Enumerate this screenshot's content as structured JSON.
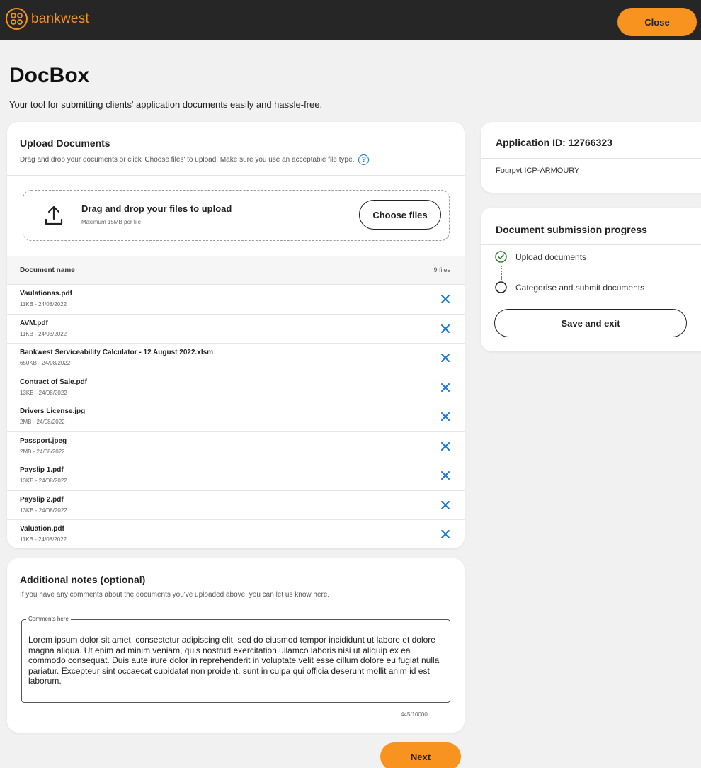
{
  "header": {
    "brand": "bankwest",
    "close_label": "Close",
    "accent_color": "#f7931e"
  },
  "page": {
    "title": "DocBox",
    "subtitle": "Your tool for submitting clients' application documents easily and hassle-free."
  },
  "upload": {
    "title": "Upload Documents",
    "description": "Drag and drop your documents or click 'Choose files' to upload. Make sure you use an acceptable file type.",
    "dropzone_title": "Drag and drop your files to upload",
    "dropzone_sub": "Maximum 15MB per file",
    "choose_label": "Choose files",
    "column_name": "Document name",
    "file_count": "9 files",
    "files": [
      {
        "name": "Vaulationas.pdf",
        "meta": "11KB - 24/08/2022"
      },
      {
        "name": "AVM.pdf",
        "meta": "11KB - 24/08/2022"
      },
      {
        "name": "Bankwest Serviceability Calculator - 12 August 2022.xlsm",
        "meta": "650KB - 24/08/2022"
      },
      {
        "name": "Contract of Sale.pdf",
        "meta": "13KB - 24/08/2022"
      },
      {
        "name": "Drivers License.jpg",
        "meta": "2MB - 24/08/2022"
      },
      {
        "name": "Passport.jpeg",
        "meta": "2MB - 24/08/2022"
      },
      {
        "name": "Payslip 1.pdf",
        "meta": "13KB - 24/08/2022"
      },
      {
        "name": "Payslip 2.pdf",
        "meta": "13KB - 24/08/2022"
      },
      {
        "name": "Valuation.pdf",
        "meta": "11KB - 24/08/2022"
      }
    ]
  },
  "notes": {
    "title": "Additional notes (optional)",
    "description": "If you have any comments about the documents you've uploaded above, you can let us know here.",
    "field_label": "Comments here",
    "value": "Lorem ipsum dolor sit amet, consectetur adipiscing elit, sed do eiusmod tempor incididunt ut labore et dolore magna aliqua. Ut enim ad minim veniam, quis nostrud exercitation ullamco laboris nisi ut aliquip ex ea commodo consequat. Duis aute irure dolor in reprehenderit in voluptate velit esse cillum dolore eu fugiat nulla pariatur. Excepteur sint occaecat cupidatat non proident, sunt in culpa qui officia deserunt mollit anim id est laborum.",
    "char_count": "445/10000"
  },
  "next_label": "Next",
  "application": {
    "title": "Application ID: 12766323",
    "name": "Fourpvt ICP-ARMOURY"
  },
  "progress": {
    "title": "Document submission progress",
    "steps": [
      {
        "label": "Upload documents",
        "state": "complete"
      },
      {
        "label": "Categorise and submit documents",
        "state": "pending"
      }
    ],
    "save_label": "Save and exit"
  }
}
